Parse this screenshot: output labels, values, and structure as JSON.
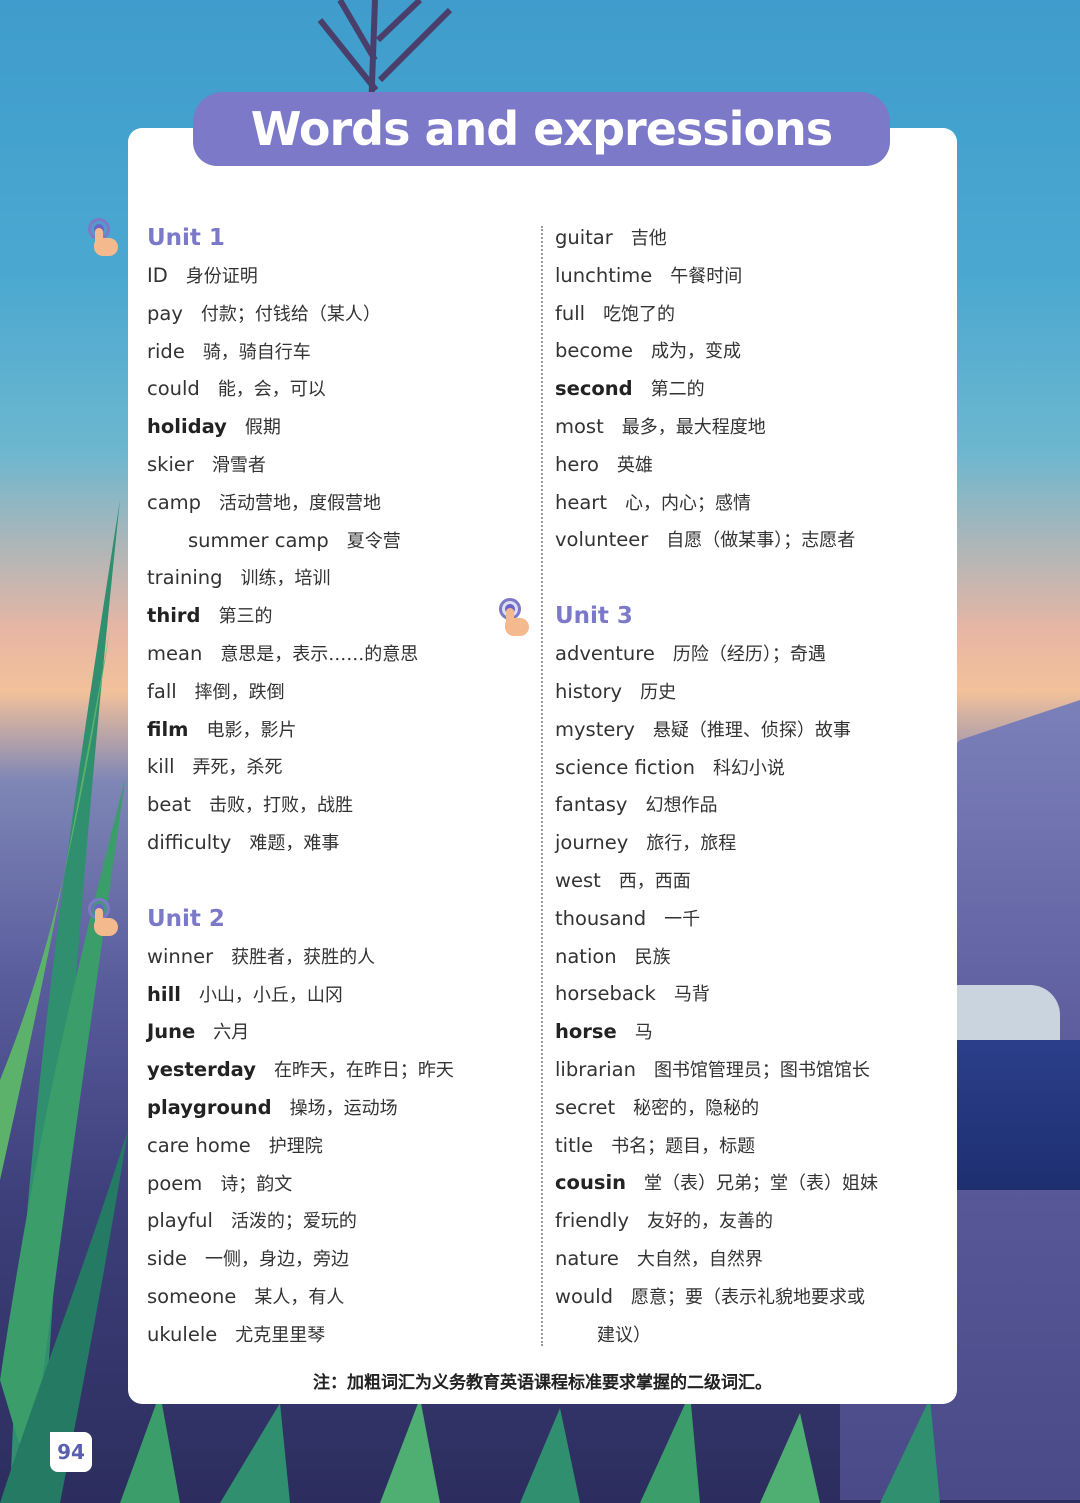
{
  "title": "Words and expressions",
  "left_column": {
    "unit1": {
      "heading": "Unit 1",
      "entries": [
        {
          "en": "ID",
          "zh": "身份证明",
          "bold": false
        },
        {
          "en": "pay",
          "zh": "付款；付钱给（某人）",
          "bold": false
        },
        {
          "en": "ride",
          "zh": "骑，骑自行车",
          "bold": false
        },
        {
          "en": "could",
          "zh": "能，会，可以",
          "bold": false
        },
        {
          "en": "holiday",
          "zh": "假期",
          "bold": true
        },
        {
          "en": "skier",
          "zh": "滑雪者",
          "bold": false
        },
        {
          "en": "camp",
          "zh": "活动营地，度假营地",
          "bold": false
        },
        {
          "en": "summer camp",
          "zh": "夏令营",
          "bold": false
        },
        {
          "en": "training",
          "zh": "训练，培训",
          "bold": false
        },
        {
          "en": "third",
          "zh": "第三的",
          "bold": true
        },
        {
          "en": "mean",
          "zh": "意思是，表示……的意思",
          "bold": false
        },
        {
          "en": "fall",
          "zh": "摔倒，跌倒",
          "bold": false
        },
        {
          "en": "film",
          "zh": "电影，影片",
          "bold": true
        },
        {
          "en": "kill",
          "zh": "弄死，杀死",
          "bold": false
        },
        {
          "en": "beat",
          "zh": "击败，打败，战胜",
          "bold": false
        },
        {
          "en": "difficulty",
          "zh": "难题，难事",
          "bold": false
        }
      ]
    },
    "unit2": {
      "heading": "Unit 2",
      "entries": [
        {
          "en": "winner",
          "zh": "获胜者，获胜的人",
          "bold": false
        },
        {
          "en": "hill",
          "zh": "小山，小丘，山冈",
          "bold": true
        },
        {
          "en": "June",
          "zh": "六月",
          "bold": true
        },
        {
          "en": "yesterday",
          "zh": "在昨天，在昨日；昨天",
          "bold": true
        },
        {
          "en": "playground",
          "zh": "操场，运动场",
          "bold": true
        },
        {
          "en": "care home",
          "zh": "护理院",
          "bold": false
        },
        {
          "en": "poem",
          "zh": "诗；韵文",
          "bold": false
        },
        {
          "en": "playful",
          "zh": "活泼的；爱玩的",
          "bold": false
        },
        {
          "en": "side",
          "zh": "一侧，身边，旁边",
          "bold": false
        },
        {
          "en": "someone",
          "zh": "某人，有人",
          "bold": false
        },
        {
          "en": "ukulele",
          "zh": "尤克里里琴",
          "bold": false
        }
      ]
    }
  },
  "right_column": {
    "unit2_cont": {
      "entries": [
        {
          "en": "guitar",
          "zh": "吉他",
          "bold": false
        },
        {
          "en": "lunchtime",
          "zh": "午餐时间",
          "bold": false
        },
        {
          "en": "full",
          "zh": "吃饱了的",
          "bold": false
        },
        {
          "en": "become",
          "zh": "成为，变成",
          "bold": false
        },
        {
          "en": "second",
          "zh": "第二的",
          "bold": true
        },
        {
          "en": "most",
          "zh": "最多，最大程度地",
          "bold": false
        },
        {
          "en": "hero",
          "zh": "英雄",
          "bold": false
        },
        {
          "en": "heart",
          "zh": "心，内心；感情",
          "bold": false
        },
        {
          "en": "volunteer",
          "zh": "自愿（做某事）；志愿者",
          "bold": false
        }
      ]
    },
    "unit3": {
      "heading": "Unit 3",
      "entries": [
        {
          "en": "adventure",
          "zh": "历险（经历）；奇遇",
          "bold": false
        },
        {
          "en": "history",
          "zh": "历史",
          "bold": false
        },
        {
          "en": "mystery",
          "zh": "悬疑（推理、侦探）故事",
          "bold": false
        },
        {
          "en": "science fiction",
          "zh": "科幻小说",
          "bold": false
        },
        {
          "en": "fantasy",
          "zh": "幻想作品",
          "bold": false
        },
        {
          "en": "journey",
          "zh": "旅行，旅程",
          "bold": false
        },
        {
          "en": "west",
          "zh": "西，西面",
          "bold": false
        },
        {
          "en": "thousand",
          "zh": "一千",
          "bold": false
        },
        {
          "en": "nation",
          "zh": "民族",
          "bold": false
        },
        {
          "en": "horseback",
          "zh": "马背",
          "bold": false
        },
        {
          "en": "horse",
          "zh": "马",
          "bold": true
        },
        {
          "en": "librarian",
          "zh": "图书馆管理员；图书馆馆长",
          "bold": false
        },
        {
          "en": "secret",
          "zh": "秘密的，隐秘的",
          "bold": false
        },
        {
          "en": "title",
          "zh": "书名；题目，标题",
          "bold": false
        },
        {
          "en": "cousin",
          "zh": "堂（表）兄弟；堂（表）姐妹",
          "bold": true
        },
        {
          "en": "friendly",
          "zh": "友好的，友善的",
          "bold": false
        },
        {
          "en": "nature",
          "zh": "大自然，自然界",
          "bold": false
        },
        {
          "en": "would",
          "zh": "愿意；要（表示礼貌地要求或",
          "bold": false
        }
      ],
      "continuation": "建议）"
    }
  },
  "footnote": "注：加粗词汇为义务教育英语课程标准要求掌握的二级词汇。",
  "page_number": "94",
  "colors": {
    "accent": "#7b79c8",
    "text": "#333333",
    "card": "#ffffff"
  }
}
